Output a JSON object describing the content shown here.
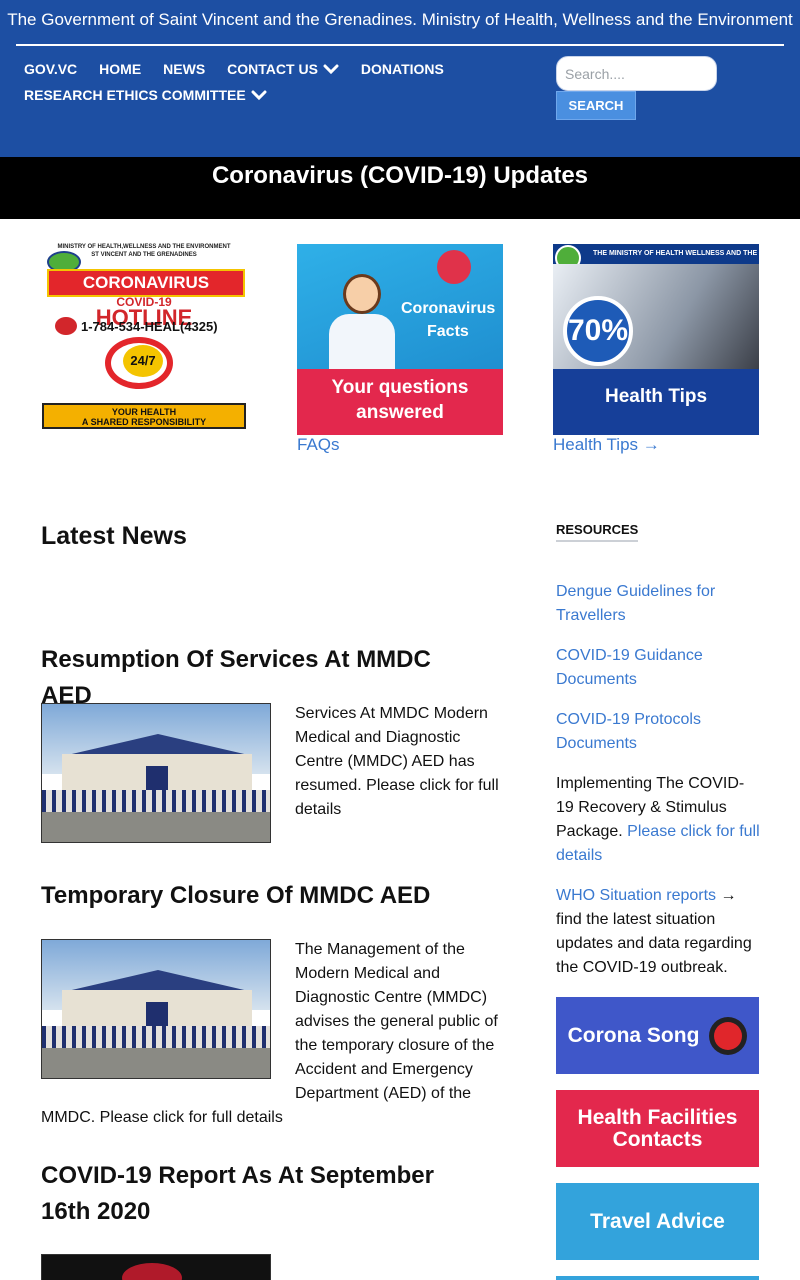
{
  "header": {
    "title": "The Government of Saint Vincent and the Grenadines. Ministry of Health, Wellness and the Environment",
    "nav_row1": [
      "GOV.VC",
      "HOME",
      "NEWS",
      "CONTACT US",
      "DONATIONS"
    ],
    "nav_row2": [
      "RESEARCH ETHICS COMMITTEE"
    ],
    "search": {
      "placeholder": "Search....",
      "button": "SEARCH"
    }
  },
  "banner": {
    "title": "Coronavirus (COVID-19) Updates"
  },
  "features": {
    "hotline": {
      "top_line1": "MINISTRY OF HEALTH,WELLNESS AND THE ENVIRONMENT",
      "top_line2": "ST VINCENT AND THE GRENADINES",
      "header": "CORONAVIRUS",
      "subtitle": "COVID-19",
      "title": "HOTLINE",
      "number": "1-784-534-HEAL(4325)",
      "hours": "24/7",
      "footer_line1": "YOUR HEALTH",
      "footer_line2": "A SHARED RESPONSIBILITY"
    },
    "facts": {
      "image_word1": "Coronavirus",
      "image_word2": "Facts",
      "image_caption": "Your questions answered",
      "link": "FAQs"
    },
    "tips": {
      "image_top": "THE MINISTRY OF HEALTH WELLNESS AND THE ENVIRONMENT",
      "image_percent": "70%",
      "image_caption": "Health Tips",
      "link": "Health Tips →"
    }
  },
  "news": {
    "heading": "Latest News",
    "articles": [
      {
        "title": "Resumption Of Services At MMDC AED",
        "text": "Services At MMDC Modern Medical and Diagnostic Centre (MMDC) AED has resumed. Please click for full details"
      },
      {
        "title": "Temporary Closure Of MMDC AED",
        "text_wrapped": "The Management of the Modern Medical and Diagnostic Centre (MMDC) advises the general public of the temporary closure of the Accident and Emergency Department (AED) of the",
        "text_tail": "MMDC. Please click for full details"
      },
      {
        "title": "COVID-19 Report As At September 16th 2020"
      }
    ]
  },
  "resources": {
    "heading": "RESOURCES",
    "links": [
      "Dengue Guidelines for Travellers",
      "COVID-19 Guidance Documents",
      "COVID-19 Protocols Documents"
    ],
    "recovery_text": "Implementing The COVID-19 Recovery & Stimulus Package.",
    "recovery_link": "Please click for full details",
    "who_link": "WHO Situation reports",
    "who_text": "→ find the latest situation updates and data regarding the COVID-19 outbreak.",
    "promos": [
      {
        "label": "Corona Song",
        "color": "#3f57c9"
      },
      {
        "label": "Health Facilities Contacts",
        "color": "#e3284d"
      },
      {
        "label": "Travel Advice",
        "color": "#33a3dc"
      }
    ]
  },
  "colors": {
    "header": "#1d4fa3",
    "link": "#3a79d0",
    "banner": "#000000"
  }
}
